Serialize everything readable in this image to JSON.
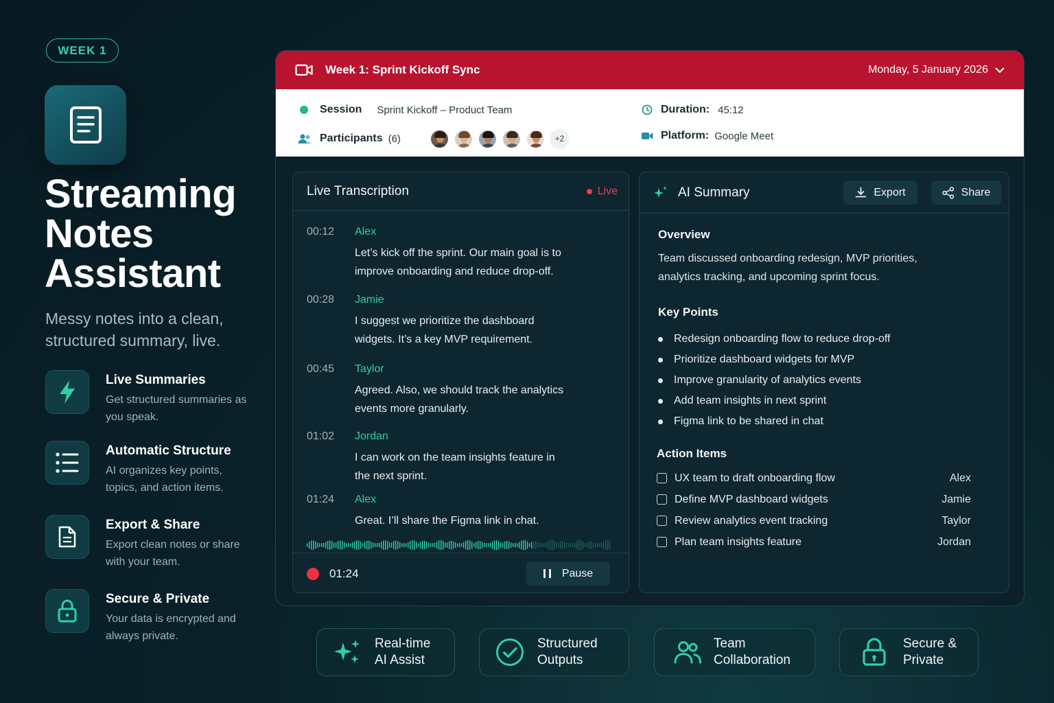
{
  "week_badge": "WEEK 1",
  "hero": {
    "title_line1": "Streaming",
    "title_line2": "Notes",
    "title_line3": "Assistant",
    "subtitle": "Messy notes into a clean, structured summary, live."
  },
  "features": [
    {
      "title": "Live Summaries",
      "desc": "Get structured summaries as you speak.",
      "icon": "lightning-icon"
    },
    {
      "title": "Automatic Structure",
      "desc": "AI organizes key points, topics, and action items.",
      "icon": "list-icon"
    },
    {
      "title": "Export & Share",
      "desc": "Export clean notes or share with your team.",
      "icon": "document-icon"
    },
    {
      "title": "Secure & Private",
      "desc": "Your data is encrypted and always private.",
      "icon": "lock-icon"
    }
  ],
  "meeting": {
    "title": "Week 1: Sprint Kickoff Sync",
    "date": "Monday, 5 January 2026",
    "session_label": "Session",
    "session_value": "Sprint Kickoff – Product Team",
    "participants_label": "Participants",
    "participants_count": "(6)",
    "participants_more": "+2",
    "duration_label": "Duration:",
    "duration_value": "45:12",
    "platform_label": "Platform:",
    "platform_value": "Google Meet"
  },
  "transcription": {
    "title": "Live Transcription",
    "live_label": "Live",
    "entries": [
      {
        "time": "00:12",
        "speaker": "Alex",
        "text": "Let’s kick off the sprint. Our main goal is to improve onboarding and reduce drop-off."
      },
      {
        "time": "00:28",
        "speaker": "Jamie",
        "text": "I suggest we prioritize the dashboard widgets. It’s a key MVP requirement."
      },
      {
        "time": "00:45",
        "speaker": "Taylor",
        "text": "Agreed. Also, we should track the analytics events more granularly."
      },
      {
        "time": "01:02",
        "speaker": "Jordan",
        "text": "I can work on the team insights feature in the next sprint."
      },
      {
        "time": "01:24",
        "speaker": "Alex",
        "text": "Great. I’ll share the Figma link in chat."
      }
    ],
    "recording_time": "01:24",
    "pause_label": "Pause"
  },
  "summary": {
    "title": "AI Summary",
    "export_label": "Export",
    "share_label": "Share",
    "overview_heading": "Overview",
    "overview_text": "Team discussed onboarding redesign, MVP priorities, analytics tracking, and upcoming sprint focus.",
    "key_points_heading": "Key Points",
    "key_points": [
      "Redesign onboarding flow to reduce drop-off",
      "Prioritize dashboard widgets for MVP",
      "Improve granularity of analytics events",
      "Add team insights in next sprint",
      "Figma link to be shared in chat"
    ],
    "action_items_heading": "Action Items",
    "action_items": [
      {
        "text": "UX team to draft onboarding flow",
        "owner": "Alex"
      },
      {
        "text": "Define MVP dashboard widgets",
        "owner": "Jamie"
      },
      {
        "text": "Review analytics event tracking",
        "owner": "Taylor"
      },
      {
        "text": "Plan team insights feature",
        "owner": "Jordan"
      }
    ]
  },
  "pills": [
    {
      "line1": "Real-time",
      "line2": "AI Assist",
      "icon": "sparkles-icon"
    },
    {
      "line1": "Structured",
      "line2": "Outputs",
      "icon": "check-circle-icon"
    },
    {
      "line1": "Team",
      "line2": "Collaboration",
      "icon": "users-icon"
    },
    {
      "line1": "Secure &",
      "line2": "Private",
      "icon": "lock-icon"
    }
  ],
  "colors": {
    "accent": "#2fcfa5",
    "header_red": "#b8142f",
    "live_red": "#ef3b4d",
    "background": "#071a22"
  }
}
